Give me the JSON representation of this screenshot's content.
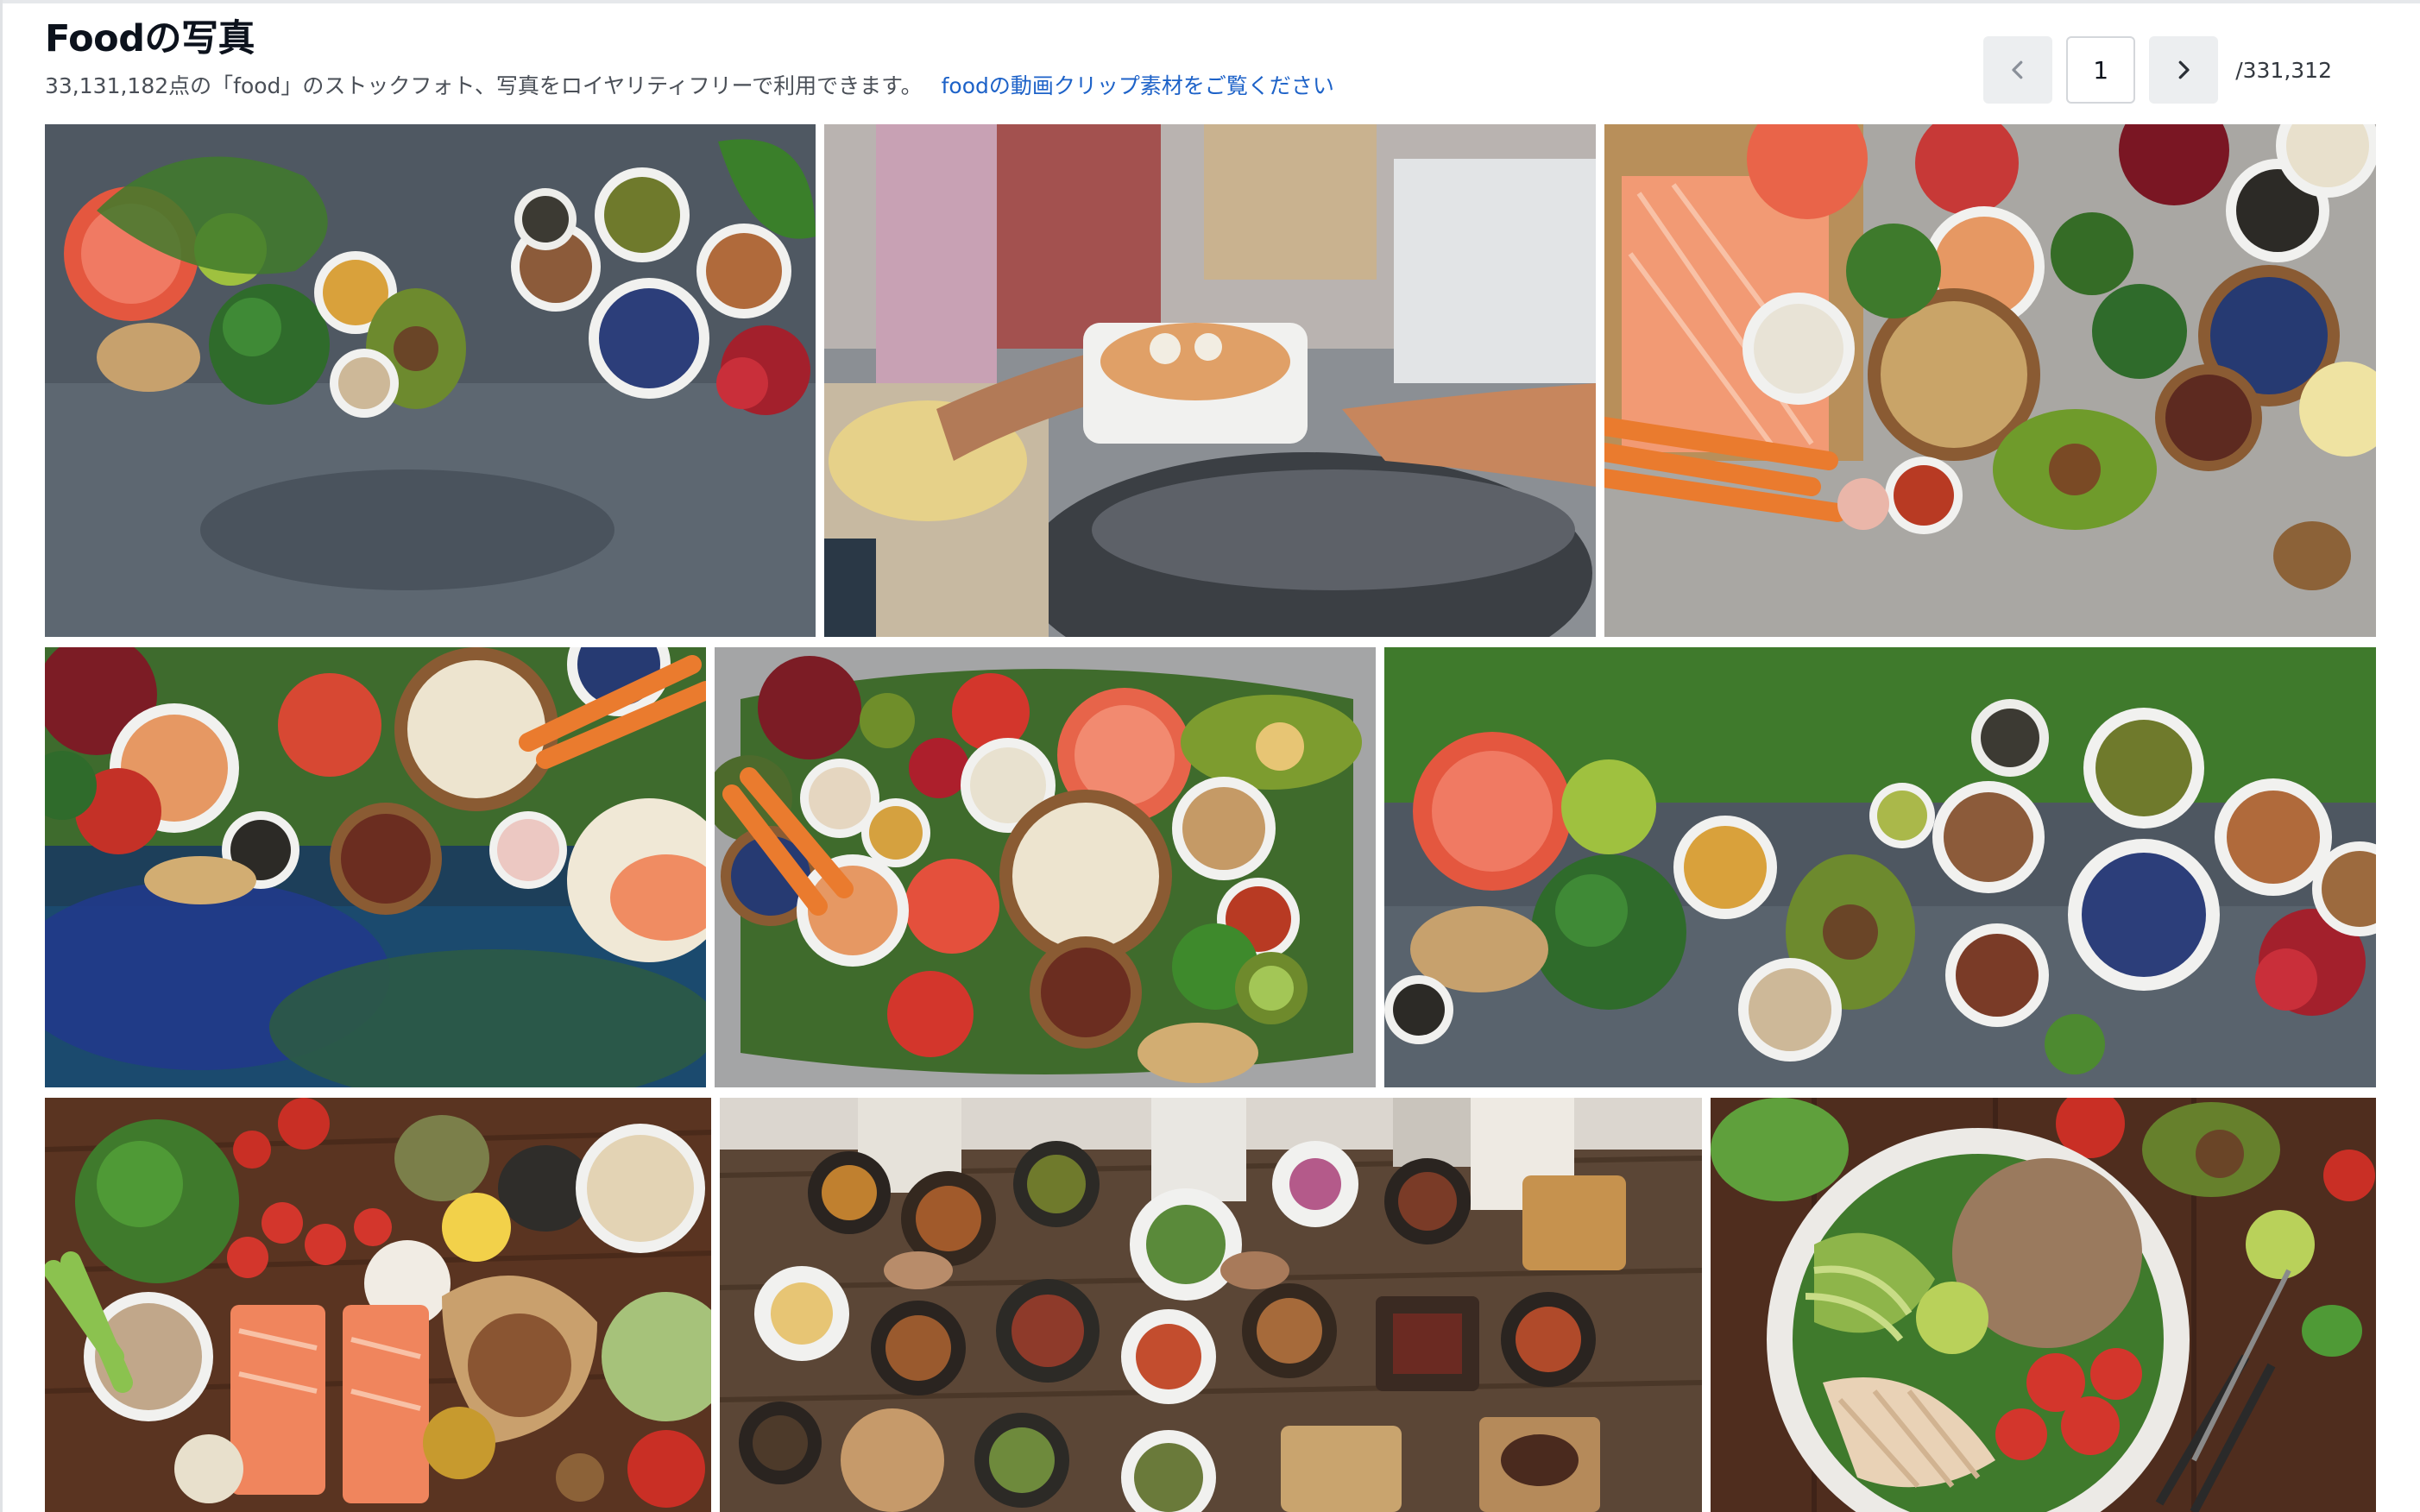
{
  "page": {
    "title": "Foodの写真",
    "subtitle": "33,131,182点の「food」のストックフォト、写真をロイヤリティフリーで利用できます。",
    "video_link": "foodの動画クリップ素材をご覧ください"
  },
  "pagination": {
    "current_page": "1",
    "total_pages": "/331,312",
    "prev_icon": "chevron-left-icon",
    "next_icon": "chevron-right-icon"
  },
  "colors": {
    "link": "#1d62c8",
    "button_bg": "#eceef0",
    "text_primary": "#0c121c"
  }
}
